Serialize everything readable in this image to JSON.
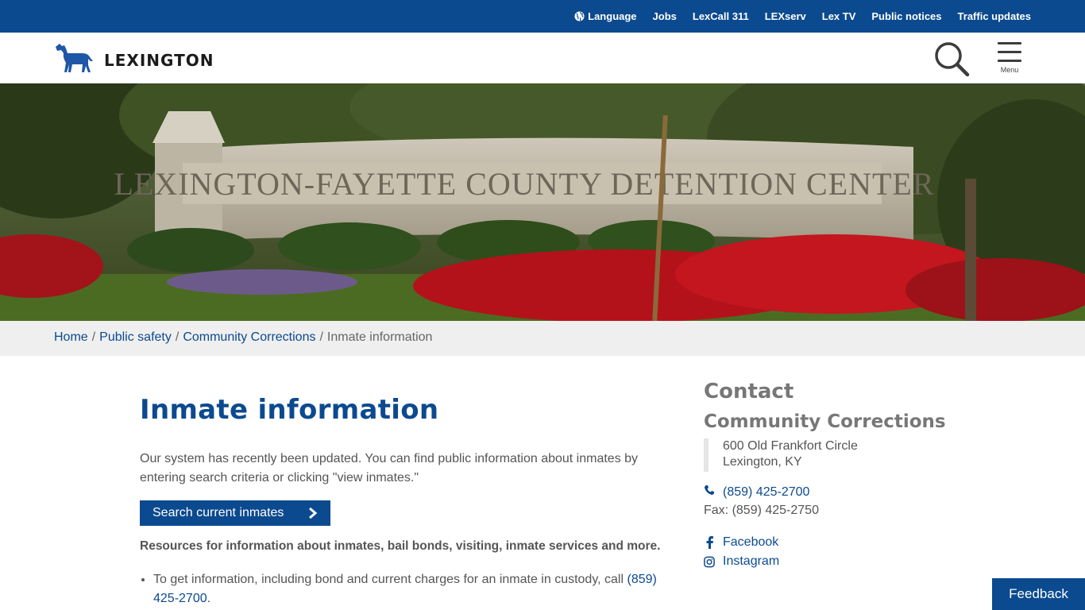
{
  "utility_nav": {
    "language": "Language",
    "jobs": "Jobs",
    "lexcall": "LexCall 311",
    "lexserv": "LEXserv",
    "lextv": "Lex TV",
    "public_notices": "Public notices",
    "traffic": "Traffic updates"
  },
  "header": {
    "logo_text": "LEXINGTON",
    "menu_label": "Menu"
  },
  "hero": {
    "sign_text": "LEXINGTON-FAYETTE COUNTY DETENTION CENTER"
  },
  "breadcrumb": {
    "items": [
      "Home",
      "Public safety",
      "Community Corrections"
    ],
    "current": "Inmate information",
    "separator": "/"
  },
  "main": {
    "title": "Inmate information",
    "intro": "Our system has recently been updated. You can find public information about inmates by entering search criteria or clicking \"view inmates.\"",
    "search_button": "Search current inmates",
    "resources": "Resources for information about inmates, bail bonds, visiting, inmate services and more.",
    "bullet1_text": "To get information, including bond and current charges for an inmate in custody, call ",
    "bullet1_link": "(859) 425-2700",
    "bullet1_end": "."
  },
  "contact": {
    "heading": "Contact",
    "org": "Community Corrections",
    "address_line1": "600 Old Frankfort Circle",
    "address_line2": "Lexington, KY",
    "phone": "(859) 425-2700",
    "fax": "Fax: (859) 425-2750",
    "facebook": "Facebook",
    "instagram": "Instagram"
  },
  "feedback_label": "Feedback",
  "colors": {
    "brand_blue": "#0c4a8f",
    "breadcrumb_bg": "#efefef"
  }
}
